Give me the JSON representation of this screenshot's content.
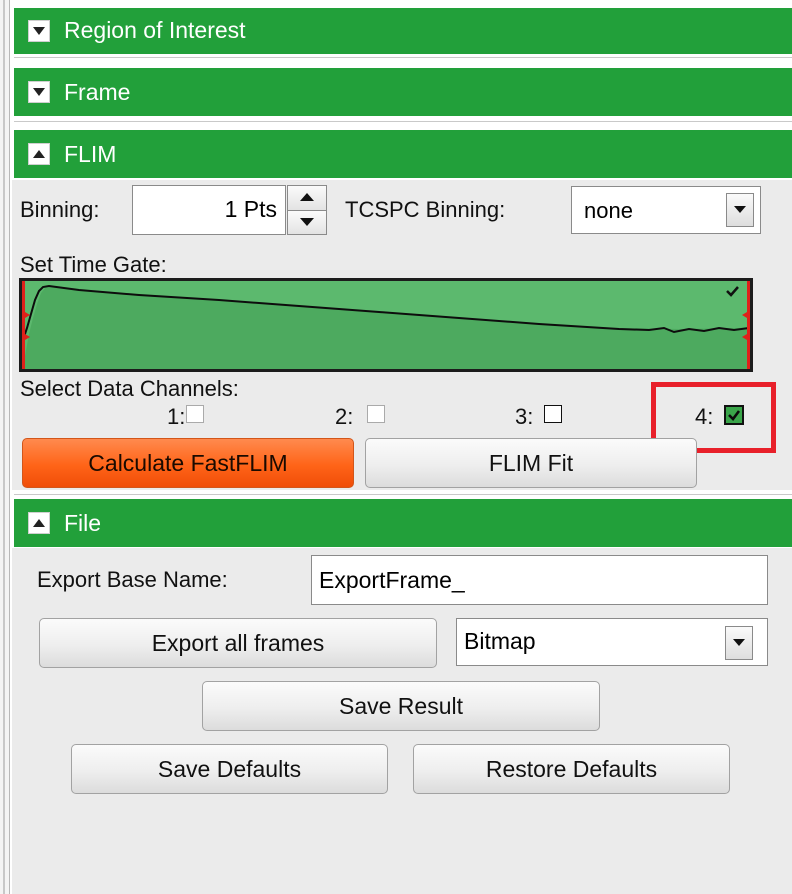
{
  "sections": {
    "roi": {
      "title": "Region of Interest",
      "toggle_icon": "triangle-down"
    },
    "frame": {
      "title": "Frame",
      "toggle_icon": "triangle-down"
    },
    "flim": {
      "title": "FLIM",
      "toggle_icon": "triangle-up"
    },
    "file": {
      "title": "File",
      "toggle_icon": "triangle-up"
    }
  },
  "flim": {
    "binning_label": "Binning:",
    "binning_value": "1 Pts",
    "tcspc_label": "TCSPC Binning:",
    "tcspc_value": "none",
    "time_gate_label": "Set Time Gate:",
    "channels_label": "Select Data Channels:",
    "channels": [
      {
        "label": "1:",
        "checked": false,
        "enabled": false
      },
      {
        "label": "2:",
        "checked": false,
        "enabled": false
      },
      {
        "label": "3:",
        "checked": false,
        "enabled": true
      },
      {
        "label": "4:",
        "checked": true,
        "enabled": true,
        "highlighted": true
      }
    ],
    "calculate_label": "Calculate FastFLIM",
    "fit_label": "FLIM Fit"
  },
  "file": {
    "export_base_label": "Export Base Name:",
    "export_base_value": "ExportFrame_",
    "export_all_label": "Export all frames",
    "format_value": "Bitmap",
    "save_result_label": "Save Result",
    "save_defaults_label": "Save Defaults",
    "restore_defaults_label": "Restore Defaults"
  },
  "colors": {
    "header_green": "#22a03a",
    "chart_fill": "#5cb96e",
    "accent_orange": "#ff6418",
    "highlight_red": "#e8202a"
  }
}
